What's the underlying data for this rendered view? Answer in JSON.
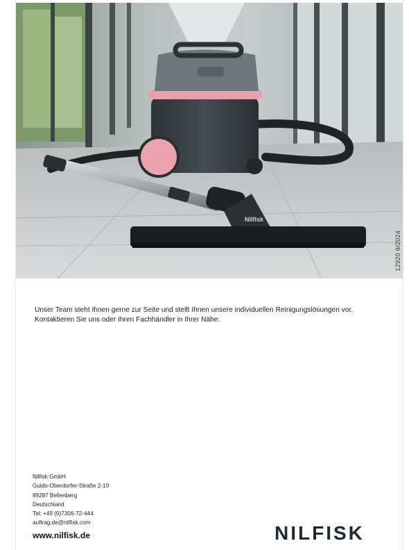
{
  "hero": {
    "print_code": "12920 9/2024",
    "brand_on_nozzle": "Nilfisk"
  },
  "intro": {
    "line1": "Unser Team steht Ihnen gerne zur Seite und stellt Ihnen unsere individuellen Reinigungslösungen vor.",
    "line2": "Kontaktieren Sie uns oder Ihren Fachhändler in Ihrer Nähe."
  },
  "contact": {
    "company": "Nilfisk GmbH",
    "street": "Guido-Oberdorfer-Straße 2-10",
    "city": "89287 Bellenberg",
    "country": "Deutschland",
    "phone": "Tel: +49 (0)7306-72-444",
    "email": "auftrag.de@nilfisk.com",
    "website": "www.nilfisk.de"
  },
  "logo": {
    "text": "NILFISK",
    "color": "#1f2a30"
  },
  "colors": {
    "vacuum_body": "#3a4046",
    "vacuum_top": "#6f767b",
    "accent_pink": "#e9a0ad",
    "floor": "#c9ccce"
  }
}
